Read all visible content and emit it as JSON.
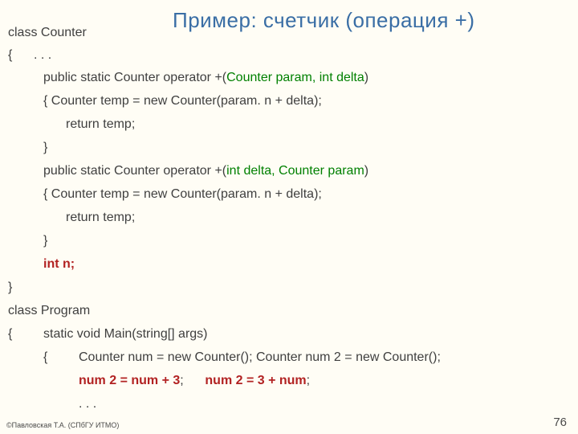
{
  "title": "Пример: счетчик (операция +)",
  "lines": {
    "l1": "class Counter",
    "l2_a": "{",
    "l2_b": ". . .",
    "l3_a": "public static Counter operator +(",
    "l3_b": "Counter param, int delta",
    "l3_c": ")",
    "l4": "{  Counter temp = new Counter(param. n + delta);",
    "l5": "return temp;",
    "l6": "}",
    "l7_a": "public static Counter operator +(",
    "l7_b": "int delta, Counter param",
    "l7_c": ")",
    "l8": "{  Counter temp = new Counter(param. n + delta);",
    "l9": "return temp;",
    "l10": "}",
    "l11": "int n;",
    "l12": "}",
    "l13": "class Program",
    "l14_a": "{",
    "l14_b": "static void Main(string[] args)",
    "l15_a": "{",
    "l15_b": "Counter num = new Counter(); Counter num 2 = new Counter();",
    "l16_a": "num 2 = num + 3",
    "l16_b": ";",
    "l16_c": "num 2 = 3 + num",
    "l16_d": ";",
    "l17": ". . ."
  },
  "footer": {
    "left": "©Павловская Т.А. (СПбГУ ИТМО)",
    "page": "76"
  }
}
